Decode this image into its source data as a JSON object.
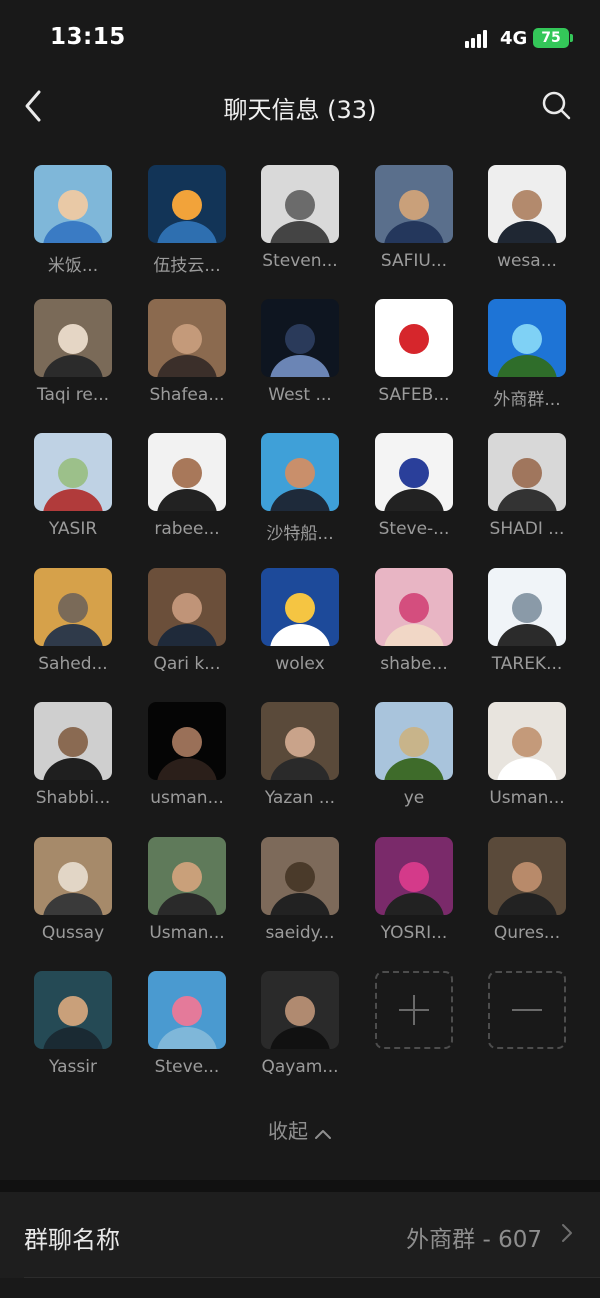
{
  "status_bar": {
    "time": "13:15",
    "network": "4G",
    "battery": "75"
  },
  "nav": {
    "title": "聊天信息 (33)"
  },
  "members": [
    {
      "name": "米饭..."
    },
    {
      "name": "伍技云..."
    },
    {
      "name": "Steven..."
    },
    {
      "name": "SAFIU..."
    },
    {
      "name": "wesa..."
    },
    {
      "name": "Taqi re..."
    },
    {
      "name": "Shafea..."
    },
    {
      "name": "West ..."
    },
    {
      "name": "SAFEB..."
    },
    {
      "name": "外商群..."
    },
    {
      "name": "YASIR"
    },
    {
      "name": "rabee..."
    },
    {
      "name": "沙特船..."
    },
    {
      "name": "Steve-..."
    },
    {
      "name": "SHADI ..."
    },
    {
      "name": "Sahed..."
    },
    {
      "name": "Qari k..."
    },
    {
      "name": "wolex"
    },
    {
      "name": "shabe..."
    },
    {
      "name": "TAREK..."
    },
    {
      "name": "Shabbi..."
    },
    {
      "name": "usman..."
    },
    {
      "name": "Yazan ..."
    },
    {
      "name": "ye"
    },
    {
      "name": "Usman..."
    },
    {
      "name": "Qussay"
    },
    {
      "name": "Usman..."
    },
    {
      "name": "saeidy..."
    },
    {
      "name": "YOSRI..."
    },
    {
      "name": "Qures..."
    },
    {
      "name": "Yassir"
    },
    {
      "name": "Steve..."
    },
    {
      "name": "Qayam..."
    }
  ],
  "actions": {
    "add_icon": "plus-icon",
    "remove_icon": "minus-icon"
  },
  "collapse_label": "收起",
  "settings": {
    "group_name_label": "群聊名称",
    "group_name_value": "外商群 - 607"
  }
}
